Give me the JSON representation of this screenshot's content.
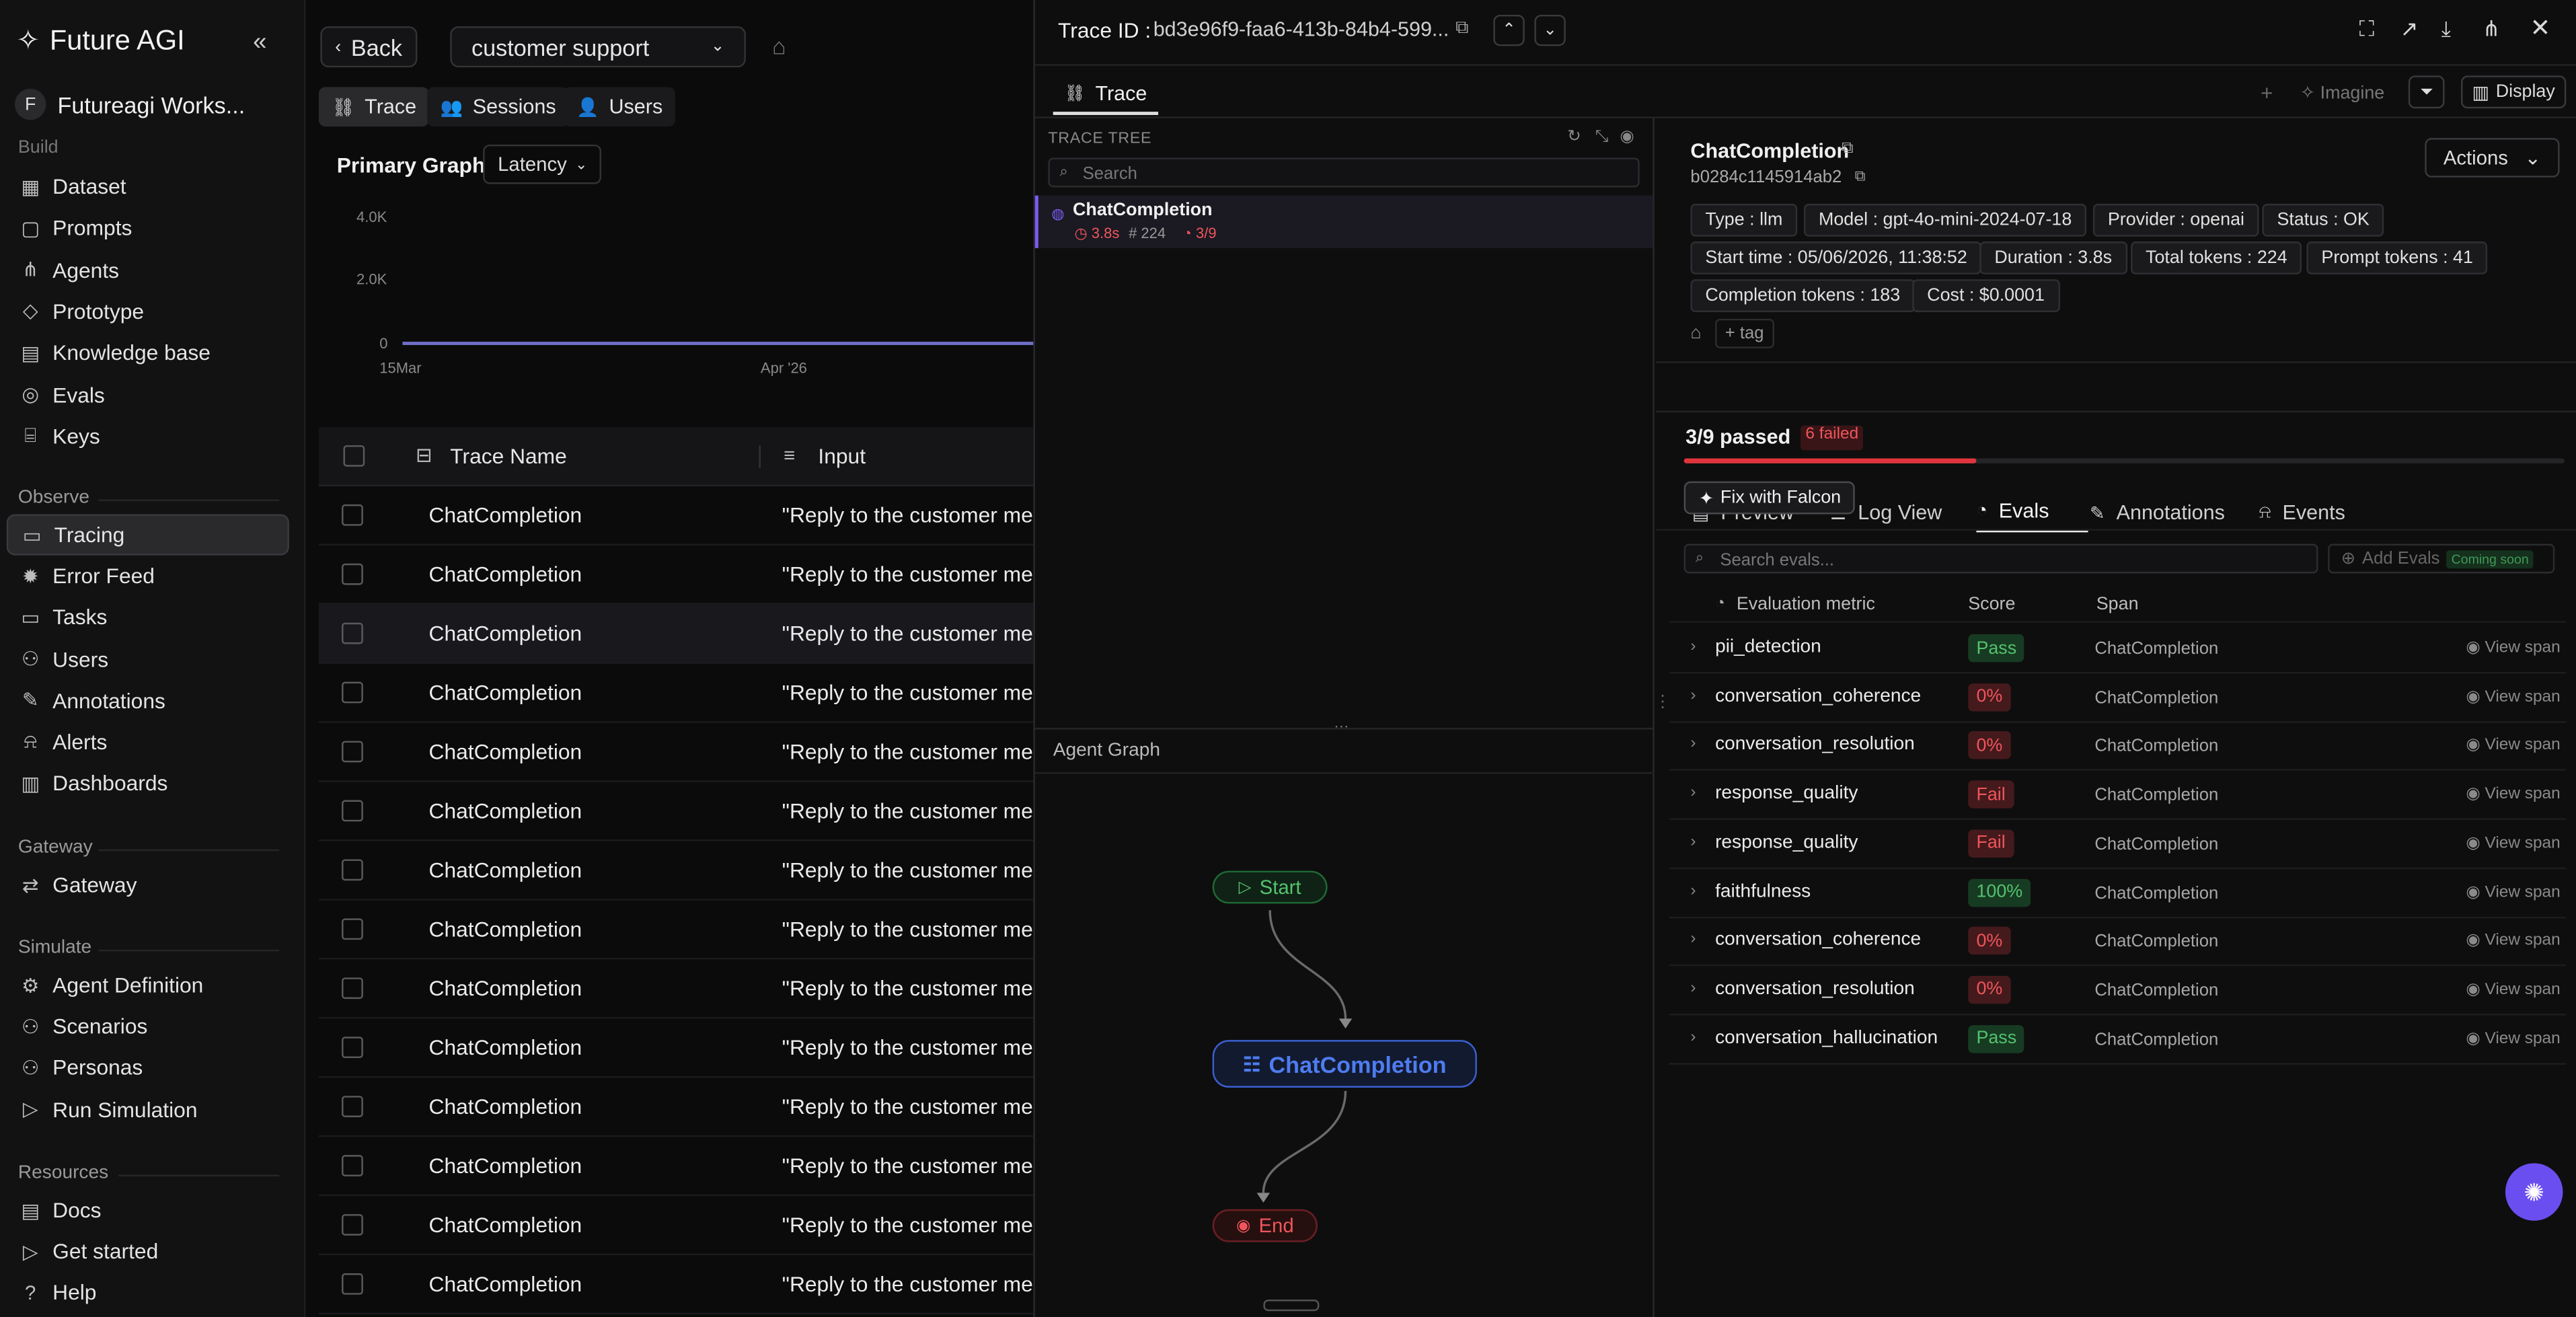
{
  "app": {
    "name": "Future AGI"
  },
  "workspace": {
    "initial": "F",
    "name": "Futureagi Works..."
  },
  "sidebar": {
    "cut_label": "Build",
    "build": [
      {
        "label": "Dataset"
      },
      {
        "label": "Prompts"
      },
      {
        "label": "Agents"
      },
      {
        "label": "Prototype"
      },
      {
        "label": "Knowledge base"
      },
      {
        "label": "Evals"
      },
      {
        "label": "Keys"
      }
    ],
    "observe_label": "Observe",
    "observe": [
      {
        "label": "Tracing"
      },
      {
        "label": "Error Feed"
      },
      {
        "label": "Tasks"
      },
      {
        "label": "Users"
      },
      {
        "label": "Annotations"
      },
      {
        "label": "Alerts"
      },
      {
        "label": "Dashboards"
      }
    ],
    "gateway_label": "Gateway",
    "gateway": [
      {
        "label": "Gateway"
      }
    ],
    "simulate_label": "Simulate",
    "simulate": [
      {
        "label": "Agent Definition"
      },
      {
        "label": "Scenarios"
      },
      {
        "label": "Personas"
      },
      {
        "label": "Run Simulation"
      }
    ],
    "resources_label": "Resources",
    "resources": [
      {
        "label": "Docs"
      },
      {
        "label": "Get started"
      },
      {
        "label": "Help"
      }
    ]
  },
  "header": {
    "back_label": "Back",
    "project_select": "customer support",
    "tabs": [
      {
        "label": "Trace"
      },
      {
        "label": "Sessions"
      },
      {
        "label": "Users"
      }
    ]
  },
  "graph": {
    "title": "Primary Graph",
    "metric": "Latency",
    "y_ticks": [
      "4.0K",
      "2.0K",
      "0"
    ],
    "x_ticks": [
      "15Mar",
      "Apr '26"
    ]
  },
  "table": {
    "columns": [
      "Trace Name",
      "Input"
    ],
    "rows": [
      {
        "name": "ChatCompletion",
        "input": "\"Reply to the customer me..."
      },
      {
        "name": "ChatCompletion",
        "input": "\"Reply to the customer me..."
      },
      {
        "name": "ChatCompletion",
        "input": "\"Reply to the customer me..."
      },
      {
        "name": "ChatCompletion",
        "input": "\"Reply to the customer me..."
      },
      {
        "name": "ChatCompletion",
        "input": "\"Reply to the customer me..."
      },
      {
        "name": "ChatCompletion",
        "input": "\"Reply to the customer me..."
      },
      {
        "name": "ChatCompletion",
        "input": "\"Reply to the customer me..."
      },
      {
        "name": "ChatCompletion",
        "input": "\"Reply to the customer me..."
      },
      {
        "name": "ChatCompletion",
        "input": "\"Reply to the customer me..."
      },
      {
        "name": "ChatCompletion",
        "input": "\"Reply to the customer me..."
      },
      {
        "name": "ChatCompletion",
        "input": "\"Reply to the customer me..."
      },
      {
        "name": "ChatCompletion",
        "input": "\"Reply to the customer me..."
      },
      {
        "name": "ChatCompletion",
        "input": "\"Reply to the customer me..."
      },
      {
        "name": "ChatCompletion",
        "input": "\"Reply to the customer me..."
      }
    ]
  },
  "trace": {
    "id_label": "Trace ID :",
    "id_value": "bd3e96f9-faa6-413b-84b4-599...",
    "tab": "Trace",
    "imagine": "Imagine",
    "display": "Display",
    "tree_label": "TRACE TREE",
    "search_placeholder": "Search",
    "node": {
      "name": "ChatCompletion",
      "latency": "3.8s",
      "tokens": "224",
      "evals": "3/9"
    },
    "agent_graph_label": "Agent Graph",
    "graph_nodes": {
      "start": "Start",
      "llm": "ChatCompletion",
      "end": "End"
    }
  },
  "detail": {
    "title": "ChatCompletion",
    "span_id": "b0284c1145914ab2",
    "actions": "Actions",
    "chips": [
      "Type : llm",
      "Model : gpt-4o-mini-2024-07-18",
      "Provider : openai",
      "Status : OK",
      "Start time : 05/06/2026, 11:38:52",
      "Duration : 3.8s",
      "Total tokens : 224",
      "Prompt tokens : 41",
      "Completion tokens : 183",
      "Cost : $0.0001"
    ],
    "tag_label": "+ tag",
    "tabs": [
      "Preview",
      "Log View",
      "Evals",
      "Annotations",
      "Events"
    ],
    "passed": "3/9 passed",
    "failed": "6 failed",
    "pass_fraction": 0.333,
    "fix_label": "Fix with Falcon",
    "search_evals_placeholder": "Search evals...",
    "add_evals": "Add Evals",
    "coming_soon": "Coming soon",
    "eval_columns": [
      "Evaluation metric",
      "Score",
      "Span"
    ],
    "view_span": "View span",
    "evals": [
      {
        "metric": "pii_detection",
        "score": "Pass",
        "status": "pass",
        "span": "ChatCompletion"
      },
      {
        "metric": "conversation_coherence",
        "score": "0%",
        "status": "fail",
        "span": "ChatCompletion"
      },
      {
        "metric": "conversation_resolution",
        "score": "0%",
        "status": "fail",
        "span": "ChatCompletion"
      },
      {
        "metric": "response_quality",
        "score": "Fail",
        "status": "fail",
        "span": "ChatCompletion"
      },
      {
        "metric": "response_quality",
        "score": "Fail",
        "status": "fail",
        "span": "ChatCompletion"
      },
      {
        "metric": "faithfulness",
        "score": "100%",
        "status": "pass",
        "span": "ChatCompletion"
      },
      {
        "metric": "conversation_coherence",
        "score": "0%",
        "status": "fail",
        "span": "ChatCompletion"
      },
      {
        "metric": "conversation_resolution",
        "score": "0%",
        "status": "fail",
        "span": "ChatCompletion"
      },
      {
        "metric": "conversation_hallucination",
        "score": "Pass",
        "status": "pass",
        "span": "ChatCompletion"
      }
    ]
  },
  "colors": {
    "accent": "#7b5cf5",
    "pass": "#54c26f",
    "fail": "#f0555c",
    "node_blue": "#4e7cf0"
  }
}
